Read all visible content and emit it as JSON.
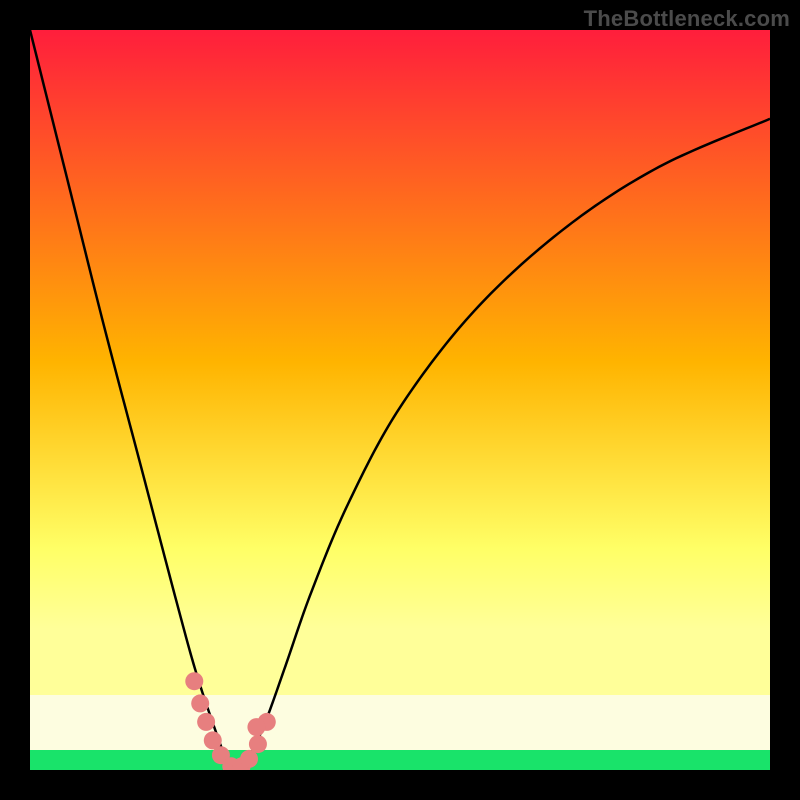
{
  "watermark": "TheBottleneck.com",
  "colors": {
    "black": "#000000",
    "curve": "#000000",
    "dots": "#e77f7f",
    "green": "#19e36a",
    "white_band": "#fdfde0"
  },
  "chart_data": {
    "type": "line",
    "title": "",
    "xlabel": "",
    "ylabel": "",
    "xlim": [
      0,
      1
    ],
    "ylim": [
      0,
      100
    ],
    "gradient_stops": [
      {
        "offset": 0.0,
        "color": "#ff1e3c"
      },
      {
        "offset": 0.5,
        "color": "#ffb400"
      },
      {
        "offset": 0.78,
        "color": "#ffff66"
      },
      {
        "offset": 0.9,
        "color": "#ffff99"
      }
    ],
    "background_shading": "vertical gradient red→orange→yellow, then pale band, then green stripe at bottom",
    "series": [
      {
        "name": "bottleneck-curve",
        "x": [
          0.0,
          0.05,
          0.1,
          0.15,
          0.2,
          0.225,
          0.25,
          0.265,
          0.275,
          0.285,
          0.3,
          0.32,
          0.345,
          0.38,
          0.43,
          0.5,
          0.6,
          0.72,
          0.85,
          1.0
        ],
        "y": [
          100.0,
          80.0,
          60.0,
          41.0,
          22.0,
          13.0,
          5.5,
          1.5,
          0.0,
          0.5,
          2.5,
          7.0,
          14.0,
          24.0,
          36.0,
          49.0,
          62.0,
          73.0,
          81.5,
          88.0
        ]
      }
    ],
    "annotations": [
      {
        "name": "highlight-dots",
        "type": "scatter",
        "points_xy": [
          [
            0.222,
            12.0
          ],
          [
            0.23,
            9.0
          ],
          [
            0.238,
            6.5
          ],
          [
            0.247,
            4.0
          ],
          [
            0.258,
            2.0
          ],
          [
            0.272,
            0.5
          ],
          [
            0.286,
            0.5
          ],
          [
            0.296,
            1.5
          ],
          [
            0.308,
            3.5
          ],
          [
            0.32,
            6.5
          ],
          [
            0.306,
            5.8
          ]
        ],
        "style": "salmon circles, r≈8px"
      }
    ]
  }
}
